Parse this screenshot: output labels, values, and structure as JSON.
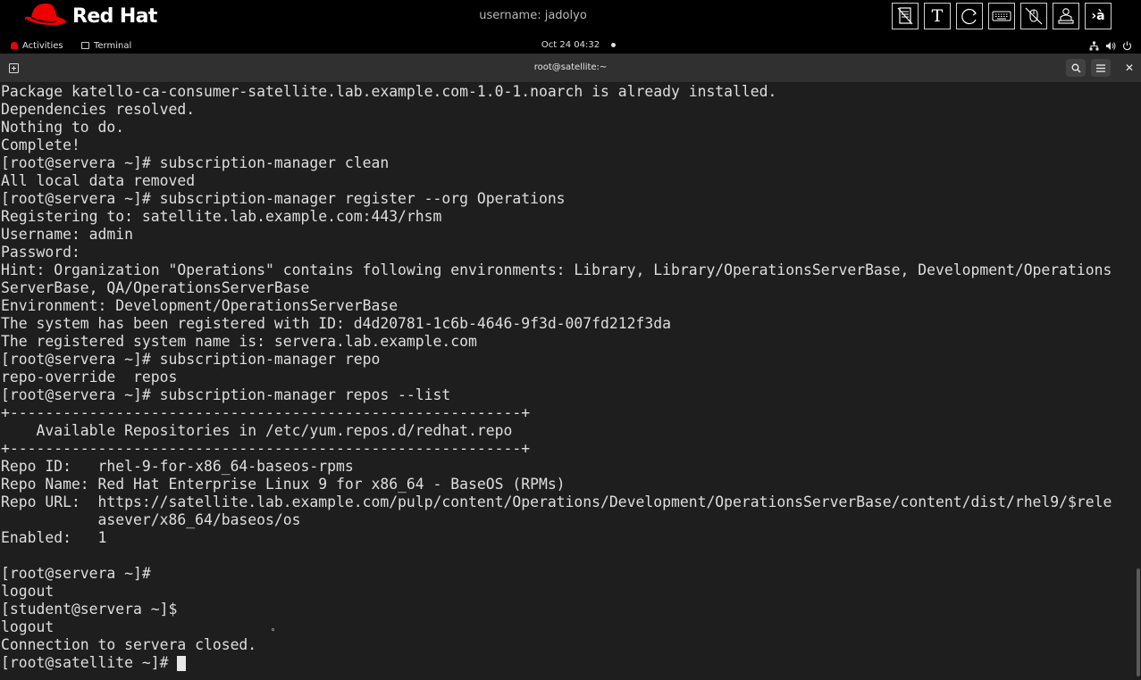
{
  "banner": {
    "brand": "Red Hat",
    "username_label": "username: jadolyo",
    "tools": [
      {
        "icon": "document-icon"
      },
      {
        "icon": "text-icon",
        "glyph": "T"
      },
      {
        "icon": "refresh-icon"
      },
      {
        "icon": "keyboard-icon"
      },
      {
        "icon": "mouse-disabled-icon"
      },
      {
        "icon": "user-at-laptop-icon"
      },
      {
        "icon": "command-prompt-icon",
        "glyph": "›à"
      }
    ]
  },
  "topbar": {
    "activities_label": "Activities",
    "app_label": "Terminal",
    "clock": "Oct 24  04:32",
    "tray_icons": [
      "network-icon",
      "volume-icon",
      "power-icon"
    ]
  },
  "window": {
    "title": "root@satellite:~",
    "buttons": [
      "new-tab-icon",
      "search-icon",
      "hamburger-menu-icon",
      "close-icon"
    ],
    "close_glyph": "✕"
  },
  "terminal": {
    "lines": [
      "Package katello-ca-consumer-satellite.lab.example.com-1.0-1.noarch is already installed.",
      "Dependencies resolved.",
      "Nothing to do.",
      "Complete!",
      "[root@servera ~]# subscription-manager clean",
      "All local data removed",
      "[root@servera ~]# subscription-manager register --org Operations",
      "Registering to: satellite.lab.example.com:443/rhsm",
      "Username: admin",
      "Password: ",
      "Hint: Organization \"Operations\" contains following environments: Library, Library/OperationsServerBase, Development/Operations",
      "ServerBase, QA/OperationsServerBase",
      "Environment: Development/OperationsServerBase",
      "The system has been registered with ID: d4d20781-1c6b-4646-9f3d-007fd212f3da",
      "The registered system name is: servera.lab.example.com",
      "[root@servera ~]# subscription-manager repo",
      "repo-override  repos",
      "[root@servera ~]# subscription-manager repos --list",
      "+----------------------------------------------------------+",
      "    Available Repositories in /etc/yum.repos.d/redhat.repo",
      "+----------------------------------------------------------+",
      "Repo ID:   rhel-9-for-x86_64-baseos-rpms",
      "Repo Name: Red Hat Enterprise Linux 9 for x86_64 - BaseOS (RPMs)",
      "Repo URL:  https://satellite.lab.example.com/pulp/content/Operations/Development/OperationsServerBase/content/dist/rhel9/$rele",
      "           asever/x86_64/baseos/os",
      "Enabled:   1",
      "",
      "[root@servera ~]# ",
      "logout",
      "[student@servera ~]$ ",
      "logout",
      "Connection to servera closed."
    ],
    "prompt": "[root@satellite ~]# "
  },
  "colors": {
    "brand_red": "#ee0000",
    "terminal_bg": "#1e1e1e",
    "terminal_fg": "#dedede",
    "header_bg": "#303030"
  }
}
